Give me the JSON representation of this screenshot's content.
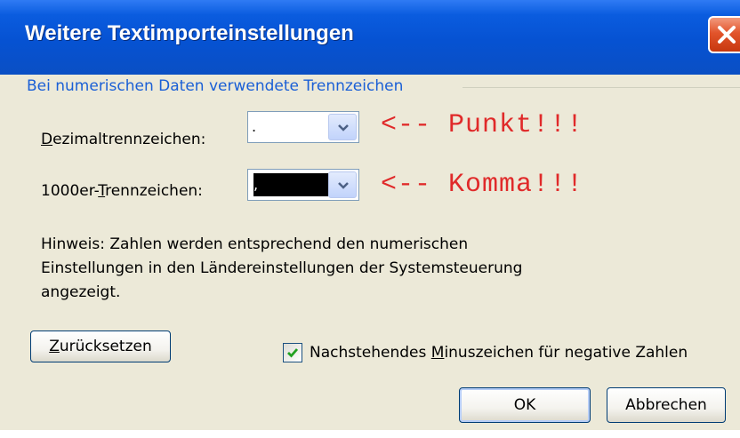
{
  "window": {
    "title": "Weitere Textimporteinstellungen"
  },
  "group": {
    "label": "Bei numerischen Daten verwendete Trennzeichen"
  },
  "decimal": {
    "label_pre": "",
    "label_key": "D",
    "label_post": "ezimaltrennzeichen:",
    "value": "."
  },
  "thousands": {
    "label_pre": "1000er-",
    "label_key": "T",
    "label_post": "rennzeichen:",
    "value": ","
  },
  "annotations": {
    "decimal": "<-- Punkt!!!",
    "thousands": "<-- Komma!!!",
    "color": "#e02a2a"
  },
  "hint": {
    "line1": "Hinweis: Zahlen werden entsprechend den numerischen",
    "line2": "Einstellungen in den Ländereinstellungen der Systemsteuerung",
    "line3": "angezeigt."
  },
  "buttons": {
    "reset_key": "Z",
    "reset_rest": "urücksetzen",
    "ok": "OK",
    "cancel": "Abbrechen"
  },
  "checkbox": {
    "checked": true,
    "label_pre": "Nachstehendes ",
    "label_key": "M",
    "label_post": "inuszeichen für negative Zahlen"
  },
  "icons": {
    "close": "close-icon",
    "dropdown": "chevron-down-icon",
    "check": "check-icon"
  },
  "colors": {
    "titlebar": "#0652d2",
    "dialog_bg": "#ece9d8",
    "group_label": "#1a5fd6"
  }
}
